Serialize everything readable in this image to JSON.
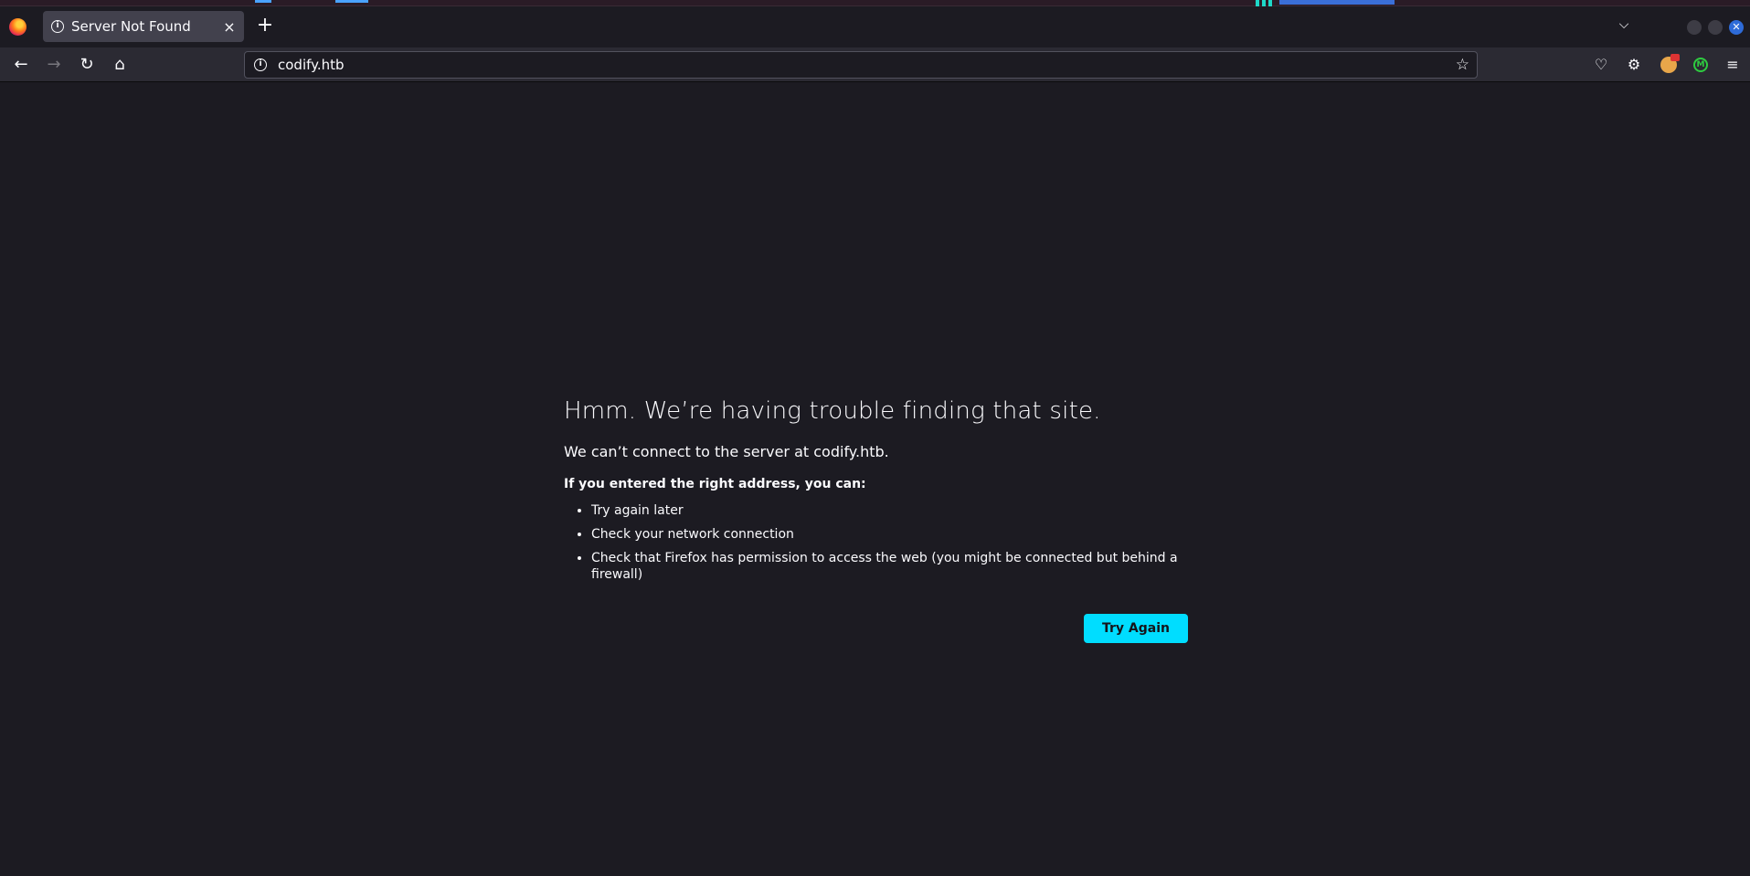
{
  "colors": {
    "page_bg": "#1c1b22",
    "toolbar_bg": "#2b2a33",
    "tab_bg": "#42414d",
    "accent_button": "#00ddff",
    "text": "#fbfbfe"
  },
  "tabbar": {
    "active_tab": {
      "title": "Server Not Found",
      "icon": "info-icon"
    },
    "new_tab_label": "+",
    "tab_list_label": "⌵",
    "window_close_label": "✕"
  },
  "navbar": {
    "back_label": "←",
    "forward_label": "→",
    "reload_label": "↻",
    "home_label": "⌂",
    "url": "codify.htb",
    "star_label": "☆",
    "pocket_label": "♡",
    "extensions_label": "⚙",
    "ext_m_label": "M",
    "menu_label": "≡"
  },
  "error_page": {
    "title": "Hmm. We’re having trouble finding that site.",
    "description": "We can’t connect to the server at codify.htb.",
    "subheading": "If you entered the right address, you can:",
    "suggestions": [
      "Try again later",
      "Check your network connection",
      "Check that Firefox has permission to access the web (you might be connected but behind a firewall)"
    ],
    "try_again_label": "Try Again"
  }
}
